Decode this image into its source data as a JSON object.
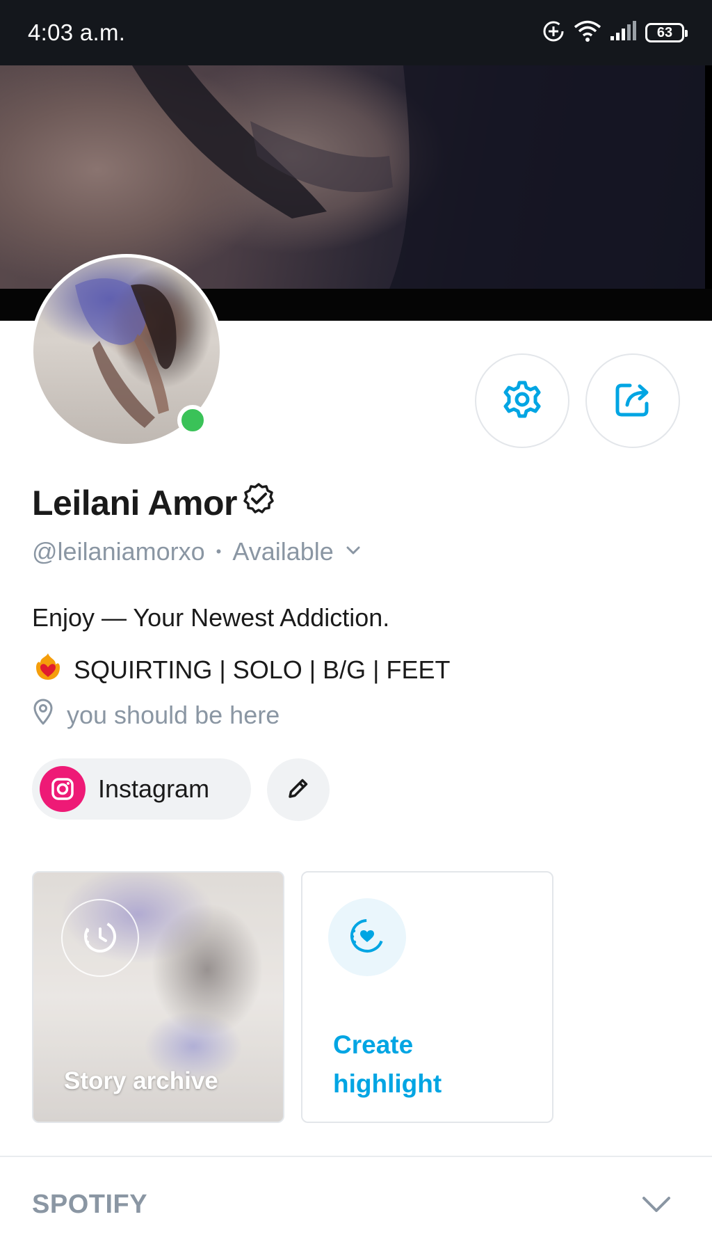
{
  "status_bar": {
    "time": "4:03 a.m.",
    "battery": "63",
    "icons": [
      "data-saver-icon",
      "wifi-icon",
      "signal-icon",
      "battery-icon"
    ]
  },
  "profile": {
    "name": "Leilani Amor",
    "handle": "@leilaniamorxo",
    "separator": "•",
    "availability": "Available",
    "online": true,
    "bio_line_1": "Enjoy — Your Newest Addiction.",
    "bio_line_2": "SQUIRTING | SOLO | B/G | FEET",
    "location": "you should be here"
  },
  "social": {
    "instagram_label": "Instagram"
  },
  "highlights": {
    "story_archive_label": "Story archive",
    "create_highlight_label": "Create highlight"
  },
  "sections": {
    "spotify_title": "SPOTIFY"
  },
  "colors": {
    "accent": "#00a5e3",
    "online": "#3ac258",
    "instagram": "#ee1a76",
    "muted_text": "#8a96a3",
    "status_bar": "#14171c"
  }
}
